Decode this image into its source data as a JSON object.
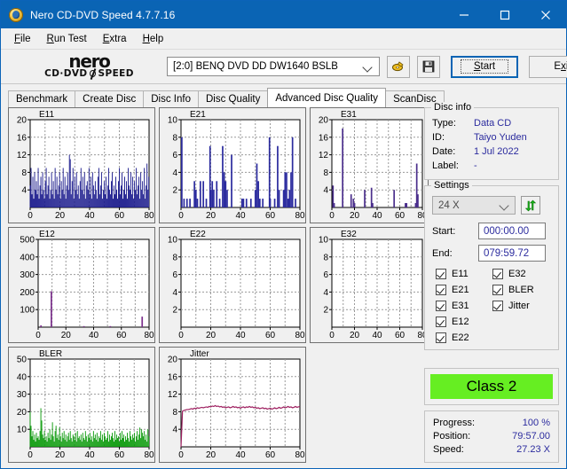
{
  "window": {
    "title": "Nero CD-DVD Speed 4.7.7.16",
    "icon": "nero-disc-icon",
    "minimize_label": "–",
    "maximize_label": "□",
    "close_label": "✕",
    "titlebar_color": "#0a64b4"
  },
  "menu": [
    {
      "label": "File",
      "accel": "F"
    },
    {
      "label": "Run Test",
      "accel": "R"
    },
    {
      "label": "Extra",
      "accel": "E"
    },
    {
      "label": "Help",
      "accel": "H"
    }
  ],
  "logo": {
    "word": "nero",
    "sub_left": "CD·DVD",
    "sub_right": "SPEED"
  },
  "toolbar": {
    "drive_value": "[2:0]   BENQ DVD DD DW1640 BSLB",
    "eject_icon": "disc-eject-icon",
    "save_icon": "floppy-save-icon",
    "start_label": "Start",
    "start_accel": "S",
    "exit_label": "Exit",
    "exit_accel": "x"
  },
  "tabs": [
    {
      "label": "Benchmark",
      "active": false
    },
    {
      "label": "Create Disc",
      "active": false
    },
    {
      "label": "Disc Info",
      "active": false
    },
    {
      "label": "Disc Quality",
      "active": false
    },
    {
      "label": "Advanced Disc Quality",
      "active": true
    },
    {
      "label": "ScanDisc",
      "active": false
    }
  ],
  "disc_info": {
    "legend": "Disc info",
    "rows": [
      {
        "key": "Type:",
        "value": "Data CD"
      },
      {
        "key": "ID:",
        "value": "Taiyo Yuden"
      },
      {
        "key": "Date:",
        "value": "1 Jul 2022"
      },
      {
        "key": "Label:",
        "value": "-"
      }
    ]
  },
  "settings": {
    "legend": "Settings",
    "speed_value": "24 X",
    "refresh_icon": "refresh-green-icon",
    "start_label": "Start:",
    "start_value": "000:00.00",
    "end_label": "End:",
    "end_value": "079:59.72",
    "checkboxes_col1": [
      {
        "label": "E11",
        "checked": true
      },
      {
        "label": "E21",
        "checked": true
      },
      {
        "label": "E31",
        "checked": true
      },
      {
        "label": "E12",
        "checked": true
      },
      {
        "label": "E22",
        "checked": true
      }
    ],
    "checkboxes_col2": [
      {
        "label": "E32",
        "checked": true
      },
      {
        "label": "BLER",
        "checked": true
      },
      {
        "label": "Jitter",
        "checked": true
      }
    ]
  },
  "result": {
    "class_label": "Class 2",
    "class_color": "#66ee22"
  },
  "status": {
    "rows": [
      {
        "key": "Progress:",
        "value": "100 %"
      },
      {
        "key": "Position:",
        "value": "79:57.00"
      },
      {
        "key": "Speed:",
        "value": "27.23 X"
      }
    ]
  },
  "chart_data": [
    {
      "type": "area",
      "name": "E11",
      "title": "E11",
      "color": "#1a1a8c",
      "xlabel": "",
      "ylabel": "",
      "xlim": [
        0,
        80
      ],
      "ylim": [
        0,
        20
      ],
      "xticks": [
        0,
        20,
        40,
        60,
        80
      ],
      "yticks": [
        4,
        8,
        12,
        16,
        20
      ],
      "grid": true,
      "x": [
        0,
        0.6,
        1.2,
        1.8,
        2.4,
        3,
        3.6,
        4.2,
        4.8,
        5.4,
        6,
        6.6,
        7.2,
        7.8,
        8.4,
        9,
        9.6,
        10.2,
        10.8,
        11.4,
        12,
        12.6,
        13.2,
        13.8,
        14.4,
        15,
        15.6,
        16.2,
        16.8,
        17.4,
        18,
        18.6,
        19.2,
        19.8,
        20.4,
        21,
        21.6,
        22.2,
        22.8,
        23.4,
        24,
        24.6,
        25.2,
        25.8,
        26.4,
        27,
        27.6,
        28.2,
        28.8,
        29.4,
        30,
        30.6,
        31.2,
        31.8,
        32.4,
        33,
        33.6,
        34.2,
        34.8,
        35.4,
        36,
        36.6,
        37.2,
        37.8,
        38.4,
        39,
        39.6,
        40.2,
        40.8,
        41.4,
        42,
        42.6,
        43.2,
        43.8,
        44.4,
        45,
        45.6,
        46.2,
        46.8,
        47.4,
        48,
        48.6,
        49.2,
        49.8,
        50.4,
        51,
        51.6,
        52.2,
        52.8,
        53.4,
        54,
        54.6,
        55.2,
        55.8,
        56.4,
        57,
        57.6,
        58.2,
        58.8,
        59.4,
        60,
        60.6,
        61.2,
        61.8,
        62.4,
        63,
        63.6,
        64.2,
        64.8,
        65.4,
        66,
        66.6,
        67.2,
        67.8,
        68.4,
        69,
        69.6,
        70.2,
        70.8,
        71.4,
        72,
        72.6,
        73.2,
        73.8,
        74.4,
        75,
        75.6,
        76.2,
        76.8,
        77.4,
        78,
        78.6,
        79.2,
        79.8
      ],
      "values": [
        5,
        9,
        3,
        7,
        2,
        8,
        4,
        6,
        3,
        9,
        2,
        5,
        7,
        3,
        8,
        4,
        2,
        6,
        9,
        3,
        5,
        7,
        2,
        4,
        8,
        3,
        6,
        2,
        9,
        4,
        7,
        3,
        5,
        8,
        2,
        6,
        4,
        9,
        3,
        7,
        2,
        5,
        8,
        4,
        12,
        11,
        3,
        6,
        9,
        2,
        7,
        4,
        8,
        3,
        5,
        2,
        6,
        9,
        4,
        7,
        3,
        8,
        2,
        5,
        6,
        4,
        9,
        3,
        7,
        2,
        8,
        5,
        3,
        6,
        4,
        2,
        7,
        9,
        3,
        5,
        8,
        2,
        4,
        6,
        3,
        7,
        2,
        5,
        9,
        4,
        3,
        6,
        8,
        2,
        5,
        3,
        7,
        4,
        2,
        6,
        9,
        3,
        5,
        8,
        2,
        4,
        7,
        3,
        6,
        2,
        9,
        5,
        4,
        8,
        3,
        7,
        2,
        6,
        4,
        9,
        3,
        5,
        7,
        2,
        8,
        4,
        6,
        3,
        9,
        2,
        5,
        10,
        4,
        7
      ]
    },
    {
      "type": "bar",
      "name": "E21",
      "title": "E21",
      "color": "#2b2b9e",
      "xlim": [
        0,
        80
      ],
      "ylim": [
        0,
        10
      ],
      "xticks": [
        0,
        20,
        40,
        60,
        80
      ],
      "yticks": [
        2,
        4,
        6,
        8,
        10
      ],
      "grid": true,
      "x": [
        0.5,
        2,
        4,
        6,
        9,
        10,
        11,
        13,
        15,
        17,
        19.5,
        20,
        21,
        22,
        24,
        26,
        28,
        29,
        30,
        31,
        34,
        41,
        42,
        44,
        47,
        50,
        51,
        52,
        53,
        55,
        59.5,
        60,
        63,
        65,
        66,
        69,
        70,
        71,
        72,
        73,
        74,
        75,
        77
      ],
      "values": [
        8,
        1,
        1,
        1,
        3,
        2,
        1,
        3,
        3,
        1,
        7,
        2,
        3,
        2,
        3,
        1,
        7,
        4,
        3,
        2,
        6,
        1,
        1,
        1,
        1,
        2,
        5,
        3,
        1,
        1,
        8,
        1,
        1,
        7,
        2,
        2,
        4,
        4,
        1,
        2,
        4,
        8,
        1
      ]
    },
    {
      "type": "bar",
      "name": "E31",
      "title": "E31",
      "color": "#4b2f8c",
      "xlim": [
        0,
        80
      ],
      "ylim": [
        0,
        20
      ],
      "xticks": [
        0,
        20,
        40,
        60,
        80
      ],
      "yticks": [
        4,
        8,
        12,
        16,
        20
      ],
      "grid": true,
      "x": [
        1,
        2,
        9.5,
        17,
        19,
        20,
        29,
        35,
        36,
        55,
        65,
        66,
        74,
        75,
        76
      ],
      "values": [
        5,
        1,
        18,
        3,
        2,
        1,
        4,
        4.5,
        1,
        4,
        1,
        1,
        1,
        10,
        3
      ]
    },
    {
      "type": "bar",
      "name": "E12",
      "title": "E12",
      "color": "#7b2f8c",
      "xlim": [
        0,
        80
      ],
      "ylim": [
        0,
        500
      ],
      "xticks": [
        0,
        20,
        40,
        60,
        80
      ],
      "yticks": [
        100,
        200,
        300,
        400,
        500
      ],
      "grid": true,
      "x": [
        2,
        9.5,
        33,
        52,
        75
      ],
      "values": [
        10,
        205,
        6,
        6,
        60
      ]
    },
    {
      "type": "bar",
      "name": "E22",
      "title": "E22",
      "color": "#2b2b9e",
      "xlim": [
        0,
        80
      ],
      "ylim": [
        0,
        10
      ],
      "xticks": [
        0,
        20,
        40,
        60,
        80
      ],
      "yticks": [
        2,
        4,
        6,
        8,
        10
      ],
      "grid": true,
      "x": [],
      "values": []
    },
    {
      "type": "bar",
      "name": "E32",
      "title": "E32",
      "color": "#2b2b9e",
      "xlim": [
        0,
        80
      ],
      "ylim": [
        0,
        10
      ],
      "xticks": [
        0,
        20,
        40,
        60,
        80
      ],
      "yticks": [
        2,
        4,
        6,
        8,
        10
      ],
      "grid": true,
      "x": [],
      "values": []
    },
    {
      "type": "area",
      "name": "BLER",
      "title": "BLER",
      "color": "#0a9a0a",
      "xlim": [
        0,
        80
      ],
      "ylim": [
        0,
        50
      ],
      "xticks": [
        0,
        20,
        40,
        60,
        80
      ],
      "yticks": [
        10,
        20,
        30,
        40,
        50
      ],
      "grid": true,
      "x": [
        0,
        0.6,
        1.2,
        1.8,
        2.4,
        3,
        3.6,
        4.2,
        4.8,
        5.4,
        6,
        6.6,
        7.2,
        7.8,
        8.4,
        9,
        9.6,
        10.2,
        10.8,
        11.4,
        12,
        12.6,
        13.2,
        13.8,
        14.4,
        15,
        15.6,
        16.2,
        16.8,
        17.4,
        18,
        18.6,
        19.2,
        19.8,
        20.4,
        21,
        21.6,
        22.2,
        22.8,
        23.4,
        24,
        24.6,
        25.2,
        25.8,
        26.4,
        27,
        27.6,
        28.2,
        28.8,
        29.4,
        30,
        30.6,
        31.2,
        31.8,
        32.4,
        33,
        33.6,
        34.2,
        34.8,
        35.4,
        36,
        36.6,
        37.2,
        37.8,
        38.4,
        39,
        39.6,
        40.2,
        40.8,
        41.4,
        42,
        42.6,
        43.2,
        43.8,
        44.4,
        45,
        45.6,
        46.2,
        46.8,
        47.4,
        48,
        48.6,
        49.2,
        49.8,
        50.4,
        51,
        51.6,
        52.2,
        52.8,
        53.4,
        54,
        54.6,
        55.2,
        55.8,
        56.4,
        57,
        57.6,
        58.2,
        58.8,
        59.4,
        60,
        60.6,
        61.2,
        61.8,
        62.4,
        63,
        63.6,
        64.2,
        64.8,
        65.4,
        66,
        66.6,
        67.2,
        67.8,
        68.4,
        69,
        69.6,
        70.2,
        70.8,
        71.4,
        72,
        72.6,
        73.2,
        73.8,
        74.4,
        75,
        75.6,
        76.2,
        76.8,
        77.4,
        78,
        78.6,
        79.2,
        79.8
      ],
      "values": [
        20,
        12,
        6,
        9,
        4,
        7,
        3,
        8,
        5,
        6,
        4,
        9,
        22,
        15,
        7,
        5,
        9,
        4,
        6,
        3,
        8,
        5,
        10,
        4,
        7,
        14,
        6,
        3,
        9,
        12,
        5,
        7,
        4,
        11,
        6,
        3,
        8,
        5,
        9,
        4,
        7,
        3,
        6,
        8,
        4,
        9,
        5,
        3,
        7,
        6,
        4,
        8,
        3,
        9,
        5,
        6,
        4,
        7,
        3,
        8,
        5,
        4,
        9,
        6,
        3,
        7,
        5,
        8,
        4,
        6,
        3,
        9,
        5,
        7,
        4,
        8,
        3,
        6,
        5,
        9,
        4,
        7,
        3,
        8,
        6,
        4,
        5,
        9,
        3,
        7,
        4,
        6,
        8,
        5,
        3,
        9,
        4,
        7,
        5,
        6,
        3,
        8,
        4,
        9,
        5,
        7,
        3,
        6,
        4,
        8,
        5,
        3,
        9,
        6,
        4,
        7,
        5,
        8,
        3,
        6,
        9,
        4,
        7,
        11,
        5,
        10,
        8,
        6,
        9,
        4,
        7,
        3,
        10,
        6
      ]
    },
    {
      "type": "line",
      "name": "Jitter",
      "title": "Jitter",
      "color": "#9e2060",
      "xlim": [
        0,
        80
      ],
      "ylim": [
        0,
        20
      ],
      "xticks": [
        0,
        20,
        40,
        60,
        80
      ],
      "yticks": [
        4,
        8,
        12,
        16,
        20
      ],
      "grid": true,
      "x": [
        0,
        1,
        2,
        3,
        4,
        5,
        6,
        7,
        8,
        9,
        10,
        11,
        12,
        13,
        14,
        15,
        16,
        17,
        18,
        19,
        20,
        21,
        22,
        23,
        24,
        25,
        26,
        27,
        28,
        29,
        30,
        31,
        32,
        33,
        34,
        35,
        36,
        37,
        38,
        39,
        40,
        41,
        42,
        43,
        44,
        45,
        46,
        47,
        48,
        49,
        50,
        51,
        52,
        53,
        54,
        55,
        56,
        57,
        58,
        59,
        60,
        61,
        62,
        63,
        64,
        65,
        66,
        67,
        68,
        69,
        70,
        71,
        72,
        73,
        74,
        75,
        76,
        77,
        78,
        79,
        80
      ],
      "values": [
        0,
        8.1,
        8.3,
        8.4,
        8.5,
        8.5,
        8.6,
        8.7,
        8.6,
        8.8,
        8.7,
        8.9,
        8.8,
        8.9,
        9,
        8.9,
        9,
        9.1,
        9,
        9.2,
        9.1,
        9.3,
        9.2,
        9.4,
        9.2,
        9.3,
        9.1,
        9.2,
        9,
        9.1,
        8.9,
        9,
        9.1,
        8.9,
        9,
        9.2,
        9,
        9.1,
        8.9,
        9,
        8.8,
        9,
        9.1,
        8.9,
        9.1,
        9,
        9.2,
        9,
        9.1,
        8.9,
        9,
        8.8,
        8.9,
        8.7,
        8.8,
        8.9,
        8.7,
        8.8,
        8.6,
        8.7,
        8.8,
        8.6,
        8.7,
        8.9,
        8.7,
        8.8,
        9,
        8.8,
        8.9,
        9.1,
        8.9,
        9,
        9.2,
        9,
        9.1,
        8.9,
        9,
        9.2,
        9,
        9.1,
        9.2
      ]
    }
  ]
}
